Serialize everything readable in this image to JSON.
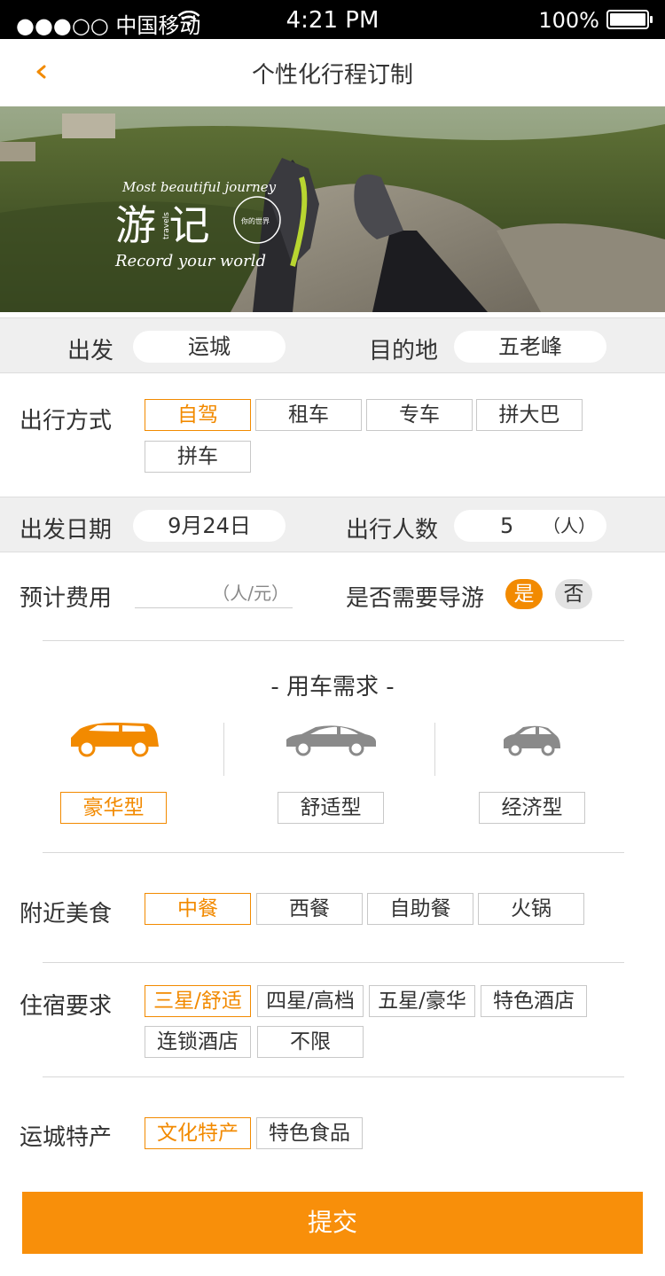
{
  "status_bar": {
    "carrier": "●●●○○ 中国移动",
    "time": "4:21 PM",
    "battery": "100%"
  },
  "nav": {
    "title": "个性化行程订制",
    "back_icon": "chevron-left-icon"
  },
  "banner": {
    "top_text": "Most beautiful journey",
    "logo_text": "游 记",
    "side_text": "travels",
    "badge_text": "你的世界",
    "bottom_text": "Record your world"
  },
  "route": {
    "depart_label": "出发",
    "depart_value": "运城",
    "dest_label": "目的地",
    "dest_value": "五老峰"
  },
  "transport": {
    "label": "出行方式",
    "options": [
      "自驾",
      "租车",
      "专车",
      "拼大巴",
      "拼车"
    ],
    "selected": "自驾"
  },
  "date_people": {
    "date_label": "出发日期",
    "date_value": "9月24日",
    "people_label": "出行人数",
    "people_value": "5",
    "people_unit": "（人）"
  },
  "cost": {
    "label": "预计费用",
    "placeholder": "（人/元）",
    "guide_label": "是否需要导游",
    "yes": "是",
    "no": "否",
    "guide_selected": "是"
  },
  "car": {
    "title": "- 用车需求 -",
    "types": [
      "豪华型",
      "舒适型",
      "经济型"
    ],
    "selected": "豪华型",
    "colors": {
      "active": "#f28a00",
      "inactive": "#8a8a8a"
    }
  },
  "food": {
    "label": "附近美食",
    "options": [
      "中餐",
      "西餐",
      "自助餐",
      "火锅"
    ],
    "selected": "中餐"
  },
  "lodging": {
    "label": "住宿要求",
    "options": [
      "三星/舒适",
      "四星/高档",
      "五星/豪华",
      "特色酒店",
      "连锁酒店",
      "不限"
    ],
    "selected": "三星/舒适"
  },
  "specialty": {
    "label": "运城特产",
    "options": [
      "文化特产",
      "特色食品"
    ],
    "selected": "文化特产"
  },
  "submit_label": "提交",
  "theme": {
    "accent": "#f28a00",
    "band": "#efefef"
  }
}
